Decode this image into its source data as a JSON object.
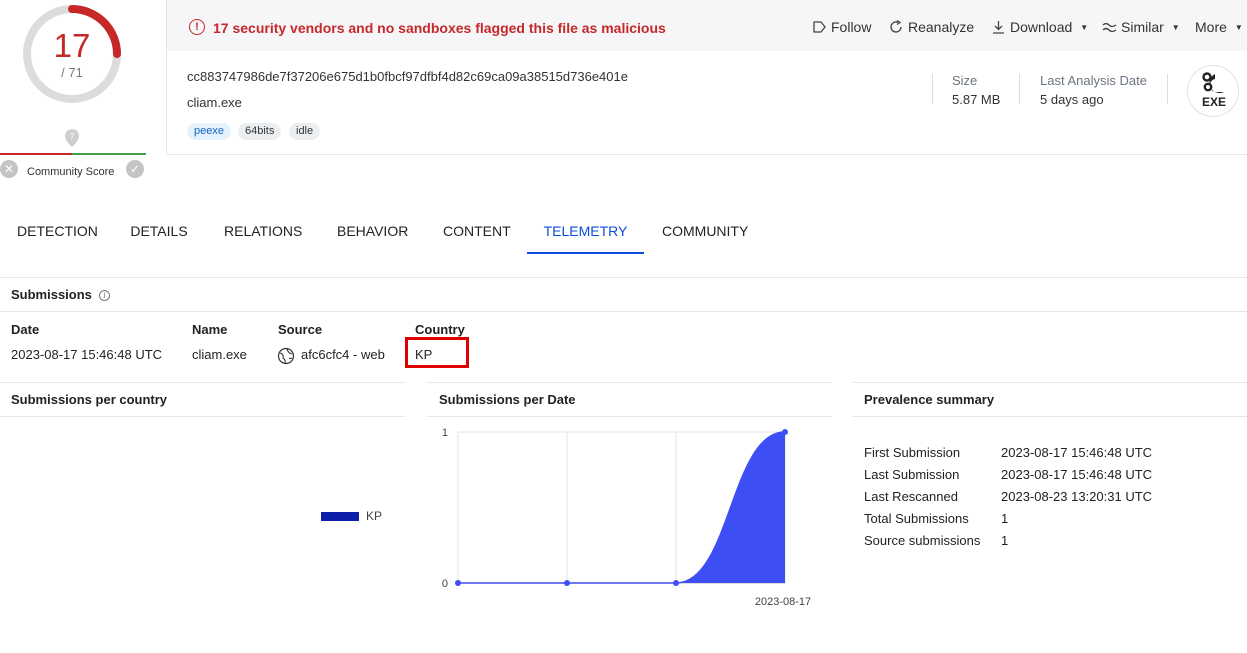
{
  "score": {
    "detections": "17",
    "total": "/ 71",
    "community_label": "Community Score"
  },
  "alert": {
    "text": "17 security vendors and no sandboxes flagged this file as malicious"
  },
  "actions": {
    "follow": "Follow",
    "reanalyze": "Reanalyze",
    "download": "Download",
    "similar": "Similar",
    "more": "More"
  },
  "file": {
    "hash": "cc883747986de7f37206e675d1b0fbcf97dfbf4d82c69ca09a38515d736e401e",
    "name": "cliam.exe",
    "tags": [
      "peexe",
      "64bits",
      "idle"
    ],
    "size_label": "Size",
    "size_value": "5.87 MB",
    "last_analysis_label": "Last Analysis Date",
    "last_analysis_value": "5 days ago",
    "type_badge": "EXE"
  },
  "tabs": [
    "DETECTION",
    "DETAILS",
    "RELATIONS",
    "BEHAVIOR",
    "CONTENT",
    "TELEMETRY",
    "COMMUNITY"
  ],
  "active_tab": "TELEMETRY",
  "submissions": {
    "title": "Submissions",
    "columns": [
      "Date",
      "Name",
      "Source",
      "Country"
    ],
    "rows": [
      {
        "date": "2023-08-17 15:46:48 UTC",
        "name": "cliam.exe",
        "source": "afc6cfc4 - web",
        "country": "KP"
      }
    ]
  },
  "per_country": {
    "title": "Submissions per country",
    "legend": "KP",
    "legend_color": "#0d1fa8"
  },
  "per_date": {
    "title": "Submissions per Date"
  },
  "chart_data": {
    "type": "area",
    "title": "Submissions per Date",
    "x_tick_labels": [
      "2023-08-17"
    ],
    "y_tick_labels": [
      "1",
      "0"
    ],
    "values": [
      0,
      0,
      0,
      1
    ],
    "ylim": [
      0,
      1
    ],
    "grid": true,
    "color": "#3d4ef5"
  },
  "prevalence": {
    "title": "Prevalence summary",
    "rows": [
      {
        "label": "First Submission",
        "value": "2023-08-17 15:46:48 UTC"
      },
      {
        "label": "Last Submission",
        "value": "2023-08-17 15:46:48 UTC"
      },
      {
        "label": "Last Rescanned",
        "value": "2023-08-23 13:20:31 UTC"
      },
      {
        "label": "Total Submissions",
        "value": "1"
      },
      {
        "label": "Source submissions",
        "value": "1"
      }
    ]
  },
  "colors": {
    "danger": "#c62828",
    "accent": "#0b4dda",
    "ok": "#43a047"
  }
}
